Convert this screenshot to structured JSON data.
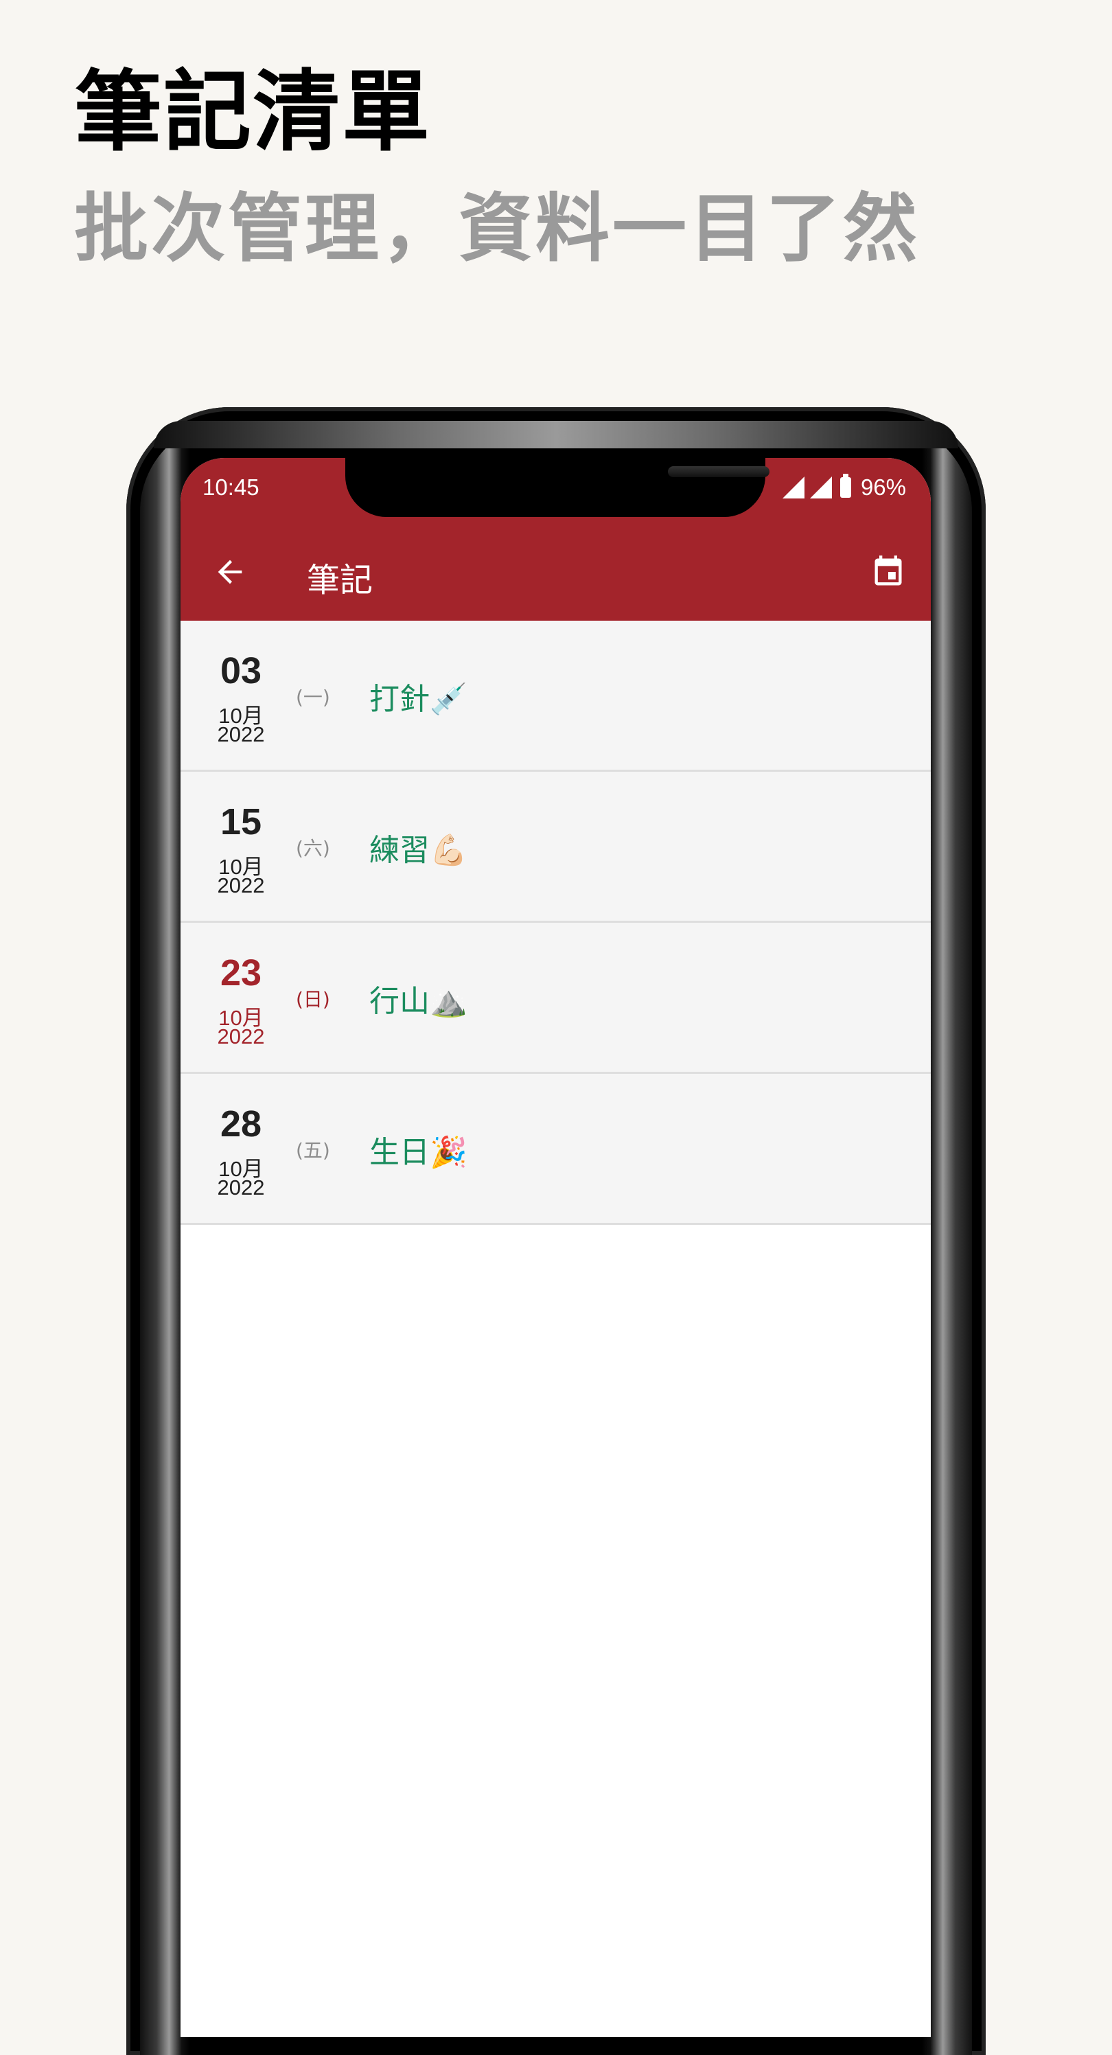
{
  "promo": {
    "headline": "筆記清單",
    "subline": "批次管理，資料一目了然"
  },
  "status_bar": {
    "time": "10:45",
    "battery": "96%"
  },
  "toolbar": {
    "title": "筆記",
    "back_icon": "arrow-left-icon",
    "calendar_icon": "calendar-icon"
  },
  "colors": {
    "app_bar": "#a3242b",
    "note_text": "#1b8c5e",
    "highlight_date": "#a3242b",
    "background": "#f8f6f2"
  },
  "notes": [
    {
      "day": "03",
      "month": "10月",
      "year": "2022",
      "weekday": "(一)",
      "title": "打針💉",
      "highlight": false
    },
    {
      "day": "15",
      "month": "10月",
      "year": "2022",
      "weekday": "(六)",
      "title": "練習💪🏻",
      "highlight": false
    },
    {
      "day": "23",
      "month": "10月",
      "year": "2022",
      "weekday": "(日)",
      "title": "行山⛰️",
      "highlight": true
    },
    {
      "day": "28",
      "month": "10月",
      "year": "2022",
      "weekday": "(五)",
      "title": "生日🎉",
      "highlight": false
    }
  ]
}
